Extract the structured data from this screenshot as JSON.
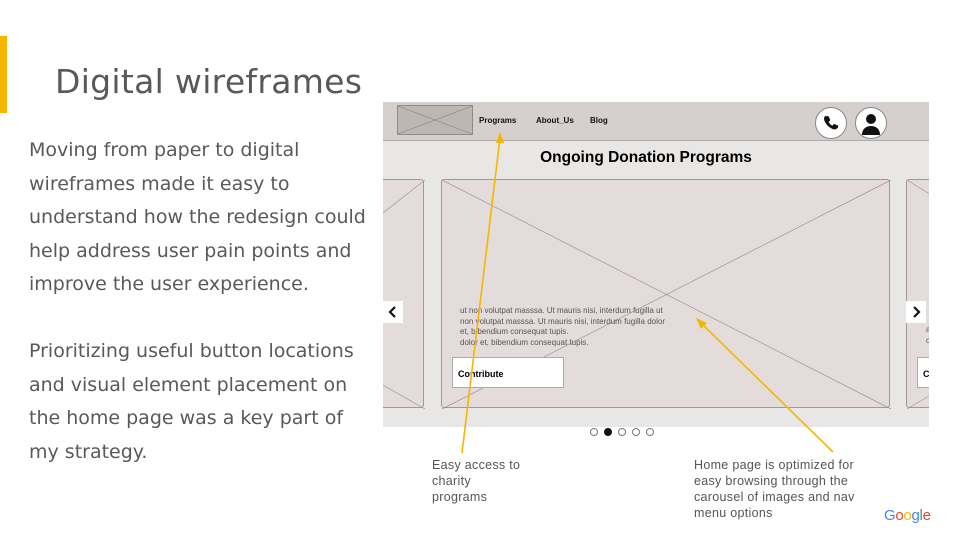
{
  "slide": {
    "title": "Digital wireframes",
    "paragraphs": [
      "Moving from paper to digital wireframes made it easy to understand how the redesign could help address user pain points and improve the user experience.",
      "Prioritizing useful button locations and visual element placement on the home page was a key part of my strategy."
    ],
    "accent_color": "#f6b600",
    "annotation_color": "#f6b600"
  },
  "wireframe": {
    "nav": {
      "links": [
        "Programs",
        "About_Us",
        "Blog"
      ],
      "icons": [
        "phone-icon",
        "user-icon"
      ]
    },
    "heading": "Ongoing Donation Programs",
    "card_text": [
      "ut non volutpat masssa. Ut mauris nisi, interdum fugilla ut",
      "non volutpat masssa. Ut mauris nisi, interdum fugilla dolor",
      "et, bibendium  consequat tupis.",
      "dolor et, bibendium  consequat tupis."
    ],
    "contribute_label": "Contribute",
    "right_card_button": "C",
    "right_card_text_fragment": [
      "a",
      "c"
    ],
    "carousel": {
      "dot_count": 5,
      "active_dot": 2
    },
    "arrow_icons": [
      "chevron-left-icon",
      "chevron-right-icon"
    ]
  },
  "annotations": {
    "left": [
      "Easy access  to",
      "charity",
      "programs"
    ],
    "right": [
      "Home page is optimized for",
      "easy browsing  through the",
      "carousel  of images  and nav",
      "menu options"
    ]
  },
  "brand": {
    "letters": [
      "G",
      "o",
      "o",
      "g",
      "l",
      "e"
    ],
    "colors": [
      "#4285F4",
      "#EA4335",
      "#FBBC05",
      "#4285F4",
      "#34A853",
      "#EA4335"
    ]
  }
}
